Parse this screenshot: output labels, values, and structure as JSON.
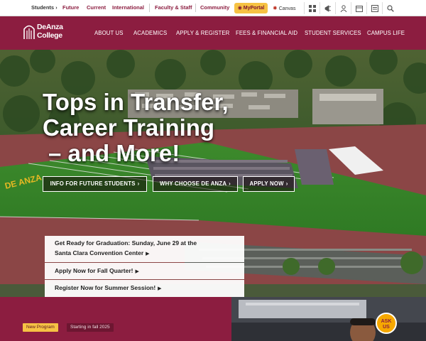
{
  "utility_bar": {
    "audience": "Students",
    "links": [
      "Future",
      "Current",
      "International",
      "Faculty & Staff",
      "Community"
    ],
    "myportal": "MyPortal",
    "canvas": "Canvas",
    "icons": [
      "grid-icon",
      "megaphone-icon",
      "user-icon",
      "calendar-icon",
      "schedule-icon",
      "search-icon"
    ]
  },
  "logo": {
    "line1": "DeAnza",
    "line2": "College"
  },
  "nav": [
    "ABOUT US",
    "ACADEMICS",
    "APPLY & REGISTER",
    "FEES & FINANCIAL AID",
    "STUDENT SERVICES",
    "CAMPUS LIFE"
  ],
  "hero": {
    "headline": [
      "Tops in Transfer,",
      "Career Training",
      "– and More!"
    ],
    "buttons": [
      "INFO FOR FUTURE STUDENTS",
      "WHY CHOOSE DE ANZA",
      "APPLY NOW"
    ],
    "news": [
      {
        "line1": "Get Ready for Graduation: Sunday, June 29 at the",
        "line2": "Santa Clara Convention Center"
      },
      {
        "line1": "Apply Now for Fall Quarter!"
      },
      {
        "line1": "Register Now for Summer Session!"
      }
    ]
  },
  "bottom": {
    "tag_new": "New Program",
    "tag_start": "Starting in fall 2025",
    "ask": [
      "ASK",
      "US"
    ]
  },
  "colors": {
    "maroon": "#8c1d40",
    "gold": "#f6c244"
  }
}
